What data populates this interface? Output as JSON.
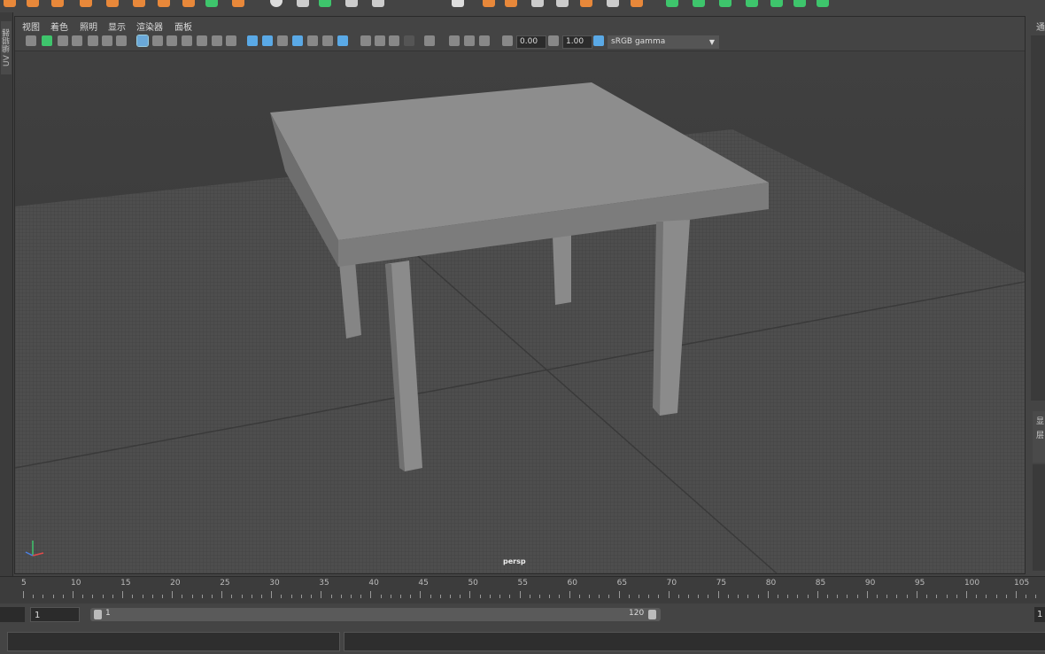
{
  "menus": [
    "视图",
    "着色",
    "照明",
    "显示",
    "渲染器",
    "面板"
  ],
  "side_tab_label": "UV 编辑器",
  "right_panel_label": "通",
  "right_panel_small": [
    "显",
    "层"
  ],
  "toolbar": {
    "exposure_value": "0.00",
    "gamma_value": "1.00",
    "color_space": "sRGB gamma"
  },
  "viewport": {
    "camera_label": "persp"
  },
  "timeline": {
    "ticks": [
      "5",
      "10",
      "15",
      "20",
      "25",
      "30",
      "35",
      "40",
      "45",
      "50",
      "55",
      "60",
      "65",
      "70",
      "75",
      "80",
      "85",
      "90",
      "95",
      "100",
      "105"
    ]
  },
  "range": {
    "start_field": "1",
    "slider_start": "1",
    "slider_end": "120",
    "right_edge": "1"
  },
  "colors": {
    "accent_blue": "#5aa9e6",
    "accent_green": "#3ec56c",
    "shelf_orange": "#e8883a"
  }
}
